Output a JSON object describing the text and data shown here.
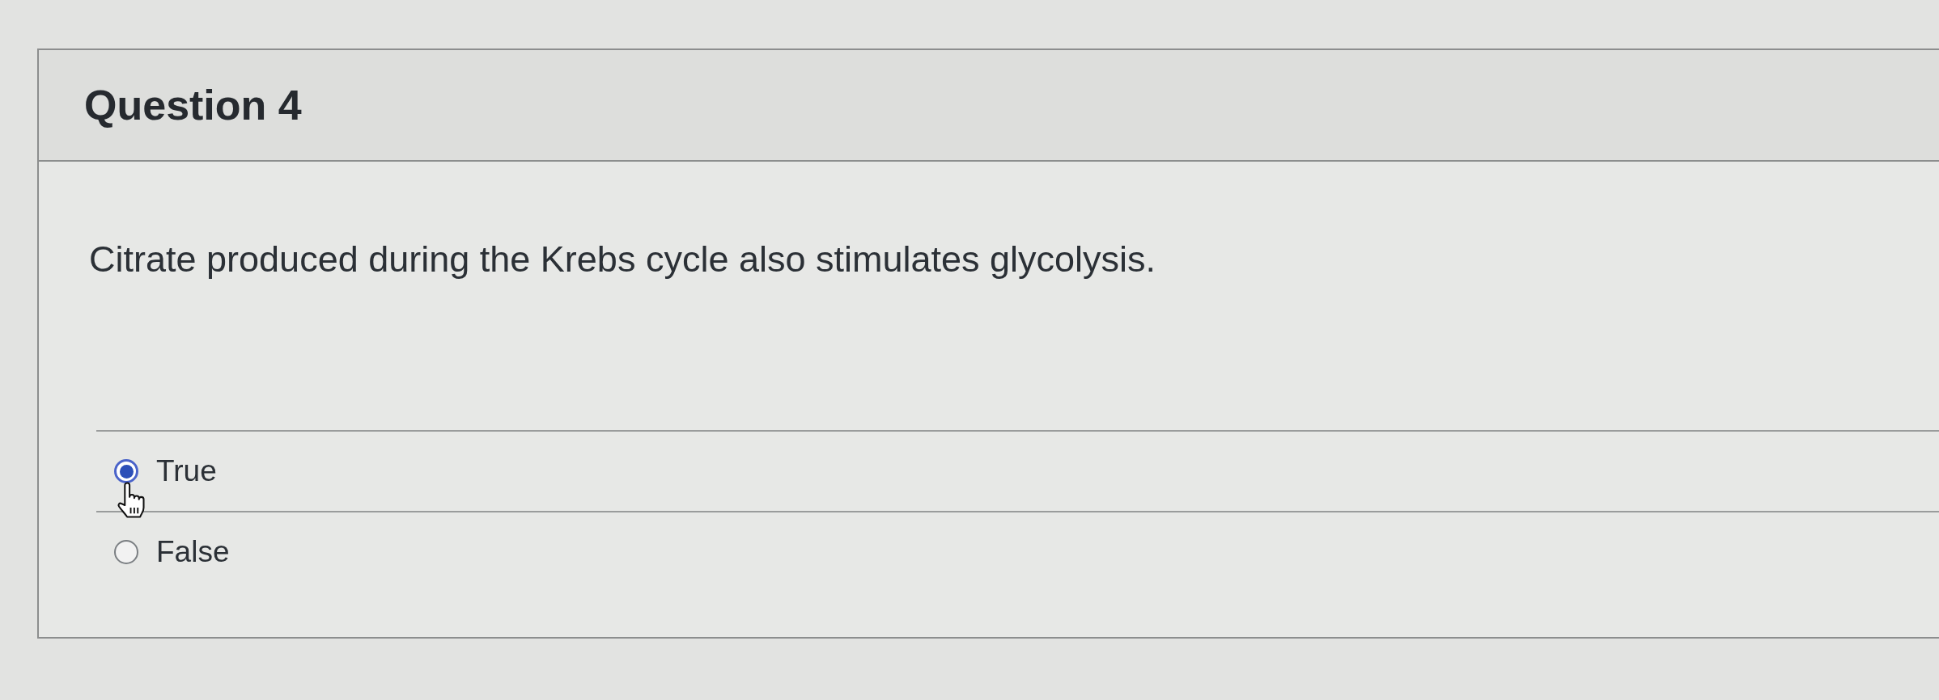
{
  "question": {
    "title": "Question 4",
    "text": "Citrate produced during the Krebs cycle also stimulates glycolysis.",
    "options": [
      {
        "label": "True",
        "selected": true,
        "hovered": true
      },
      {
        "label": "False",
        "selected": false,
        "hovered": false
      }
    ]
  }
}
